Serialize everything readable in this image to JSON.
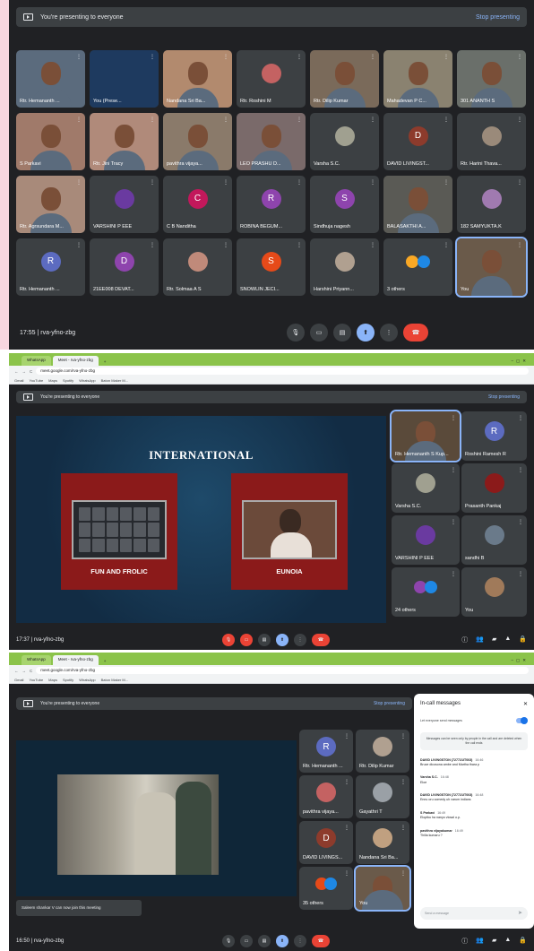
{
  "colors": {
    "meet_bg": "#202124",
    "tile_bg": "#3c4043",
    "accent_blue": "#8ab4f8",
    "end_red": "#ea4335",
    "browser_green": "#8bc34a"
  },
  "panel1": {
    "banner": {
      "text": "You're presenting to everyone",
      "stop": "Stop presenting"
    },
    "tiles": [
      {
        "name": "Rtr. Hemananth ...",
        "kind": "video",
        "color": "#5b6b7d"
      },
      {
        "name": "You (Prese...",
        "kind": "screen",
        "color": "#1e3a5f"
      },
      {
        "name": "Nandana Sri Ba...",
        "kind": "video",
        "color": "#b28a6e"
      },
      {
        "name": "Rtr. Roshini M",
        "kind": "photo",
        "color": "#c46262"
      },
      {
        "name": "Rtr. Dilip Kumar",
        "kind": "video",
        "color": "#7a6a5a"
      },
      {
        "name": "Mahadevan P C...",
        "kind": "video",
        "color": "#8a8270"
      },
      {
        "name": "301 ANANTH S",
        "kind": "video",
        "color": "#6a6f6a"
      },
      {
        "name": "S Parkavi",
        "kind": "video",
        "color": "#a07a6a"
      },
      {
        "name": "Rtr. Jini Tracy",
        "kind": "video",
        "color": "#b08a7a"
      },
      {
        "name": "pavithra vijaya...",
        "kind": "video",
        "color": "#8a7a6a"
      },
      {
        "name": "LEO PRASHU D...",
        "kind": "video",
        "color": "#7a6a6a"
      },
      {
        "name": "Varsha S.C.",
        "kind": "photo",
        "color": "#a0a090"
      },
      {
        "name": "DAVID LIVINGST...",
        "kind": "avatar",
        "letter": "D",
        "color": "#8d3b2c"
      },
      {
        "name": "Rtr. Harini Thava...",
        "kind": "photo",
        "color": "#9a8a7a"
      },
      {
        "name": "Rtr. Agrsundara M...",
        "kind": "video",
        "color": "#a88a7a"
      },
      {
        "name": "VARSHINI P EEE",
        "kind": "photo",
        "color": "#6a3aa0"
      },
      {
        "name": "C B Nanditha",
        "kind": "avatar",
        "letter": "C",
        "color": "#c2185b"
      },
      {
        "name": "ROBINA BEGUM...",
        "kind": "avatar",
        "letter": "R",
        "color": "#8e44ad"
      },
      {
        "name": "Sindhuja nagesh",
        "kind": "avatar",
        "letter": "S",
        "color": "#8e44ad"
      },
      {
        "name": "BALASAKTHI A...",
        "kind": "video",
        "color": "#5a5a55"
      },
      {
        "name": "182 SAMYUKTA.K",
        "kind": "photo",
        "color": "#a07ab0"
      },
      {
        "name": "Rtr. Hemananth ...",
        "kind": "avatar",
        "letter": "R",
        "color": "#5c6bc0"
      },
      {
        "name": "21EE008 DEVAT...",
        "kind": "avatar",
        "letter": "D",
        "color": "#8e44ad"
      },
      {
        "name": "Rtr. Solmaa A S",
        "kind": "photo",
        "color": "#c08a7a"
      },
      {
        "name": "SNOWLIN JECI...",
        "kind": "avatar",
        "letter": "S",
        "color": "#e64a19"
      },
      {
        "name": "Harshini Priyann...",
        "kind": "photo",
        "color": "#b0a090"
      },
      {
        "name": "3 others",
        "kind": "others",
        "color": "#f9a825"
      },
      {
        "name": "You",
        "kind": "self",
        "color": "#6a5a4a"
      }
    ],
    "time": "17:55",
    "meeting_code": "rva-yfno-zbg"
  },
  "browser": {
    "tab1": "WhatsApp",
    "tab2": "Meet - rva-yfno-zbg",
    "url": "meet.google.com/rva-yfno-zbg",
    "bookmarks": [
      "Gmail",
      "YouTube",
      "Maps",
      "Spotify",
      "WhatsApp",
      "Baton Maker M..."
    ]
  },
  "panel2": {
    "banner": {
      "text": "You're presenting to everyone",
      "stop": "Stop presenting"
    },
    "slide_title": "INTERNATIONAL",
    "card1": "FUN AND FROLIC",
    "card2": "EUNOIA",
    "tiles": [
      {
        "name": "Rtr. Hemananth S Kup...",
        "kind": "self",
        "color": "#5a4a3a"
      },
      {
        "name": "Roshini Ramesh R",
        "kind": "avatar",
        "letter": "R",
        "color": "#5c6bc0"
      },
      {
        "name": "Varsha S.C.",
        "kind": "photo",
        "color": "#a0a090"
      },
      {
        "name": "Prasanth Pankaj",
        "kind": "photo",
        "color": "#8b1a1a"
      },
      {
        "name": "VARSHINI P EEE",
        "kind": "photo",
        "color": "#6a3aa0"
      },
      {
        "name": "sandhi B",
        "kind": "photo",
        "color": "#6a7a8a"
      },
      {
        "name": "24 others",
        "kind": "others",
        "color": "#8e44ad"
      },
      {
        "name": "You",
        "kind": "photo",
        "color": "#a07a5a"
      }
    ],
    "time": "17:37",
    "meeting_code": "rva-yfno-zbg"
  },
  "panel3": {
    "banner": {
      "text": "You're presenting to everyone",
      "stop": "Stop presenting"
    },
    "toast": "Saleem shankar V can now join this meeting",
    "tiles": [
      {
        "name": "Rtr. Hemananth ...",
        "kind": "avatar",
        "letter": "R",
        "color": "#5c6bc0"
      },
      {
        "name": "Rtr. Dilip Kumar",
        "kind": "photo",
        "color": "#b0a090"
      },
      {
        "name": "pavithra vijaya...",
        "kind": "photo",
        "color": "#c46262"
      },
      {
        "name": "Gayathri T",
        "kind": "photo",
        "color": "#9aa0a6"
      },
      {
        "name": "DAVID LIVINGS...",
        "kind": "avatar",
        "letter": "D",
        "color": "#8d3b2c"
      },
      {
        "name": "Nandana Sri Ba...",
        "kind": "photo",
        "color": "#c0a080"
      },
      {
        "name": "35 others",
        "kind": "others",
        "color": "#e64a19"
      },
      {
        "name": "You",
        "kind": "self",
        "color": "#6a5a4a"
      }
    ],
    "chat": {
      "title": "In-call messages",
      "toggle": "Let everyone send messages",
      "note": "Messages can be seen only by people in the call and are deleted when the call ends",
      "messages": [
        {
          "who": "DAVID LIVINGSTON (727721IT003)",
          "time": "16:46",
          "text": "Bruce dicosona ambe and Martha thara p"
        },
        {
          "who": "Varsha S.C.",
          "time": "16:48",
          "text": "Eloe"
        },
        {
          "who": "DAVID LIVINGSTON (727721IT003)",
          "time": "16:48",
          "text": "Ennu oru comedy uh varum indians"
        },
        {
          "who": "S Parkavi",
          "time": "16:49",
          "text": "Eloptku ha nanyo vlosal o.p."
        },
        {
          "who": "pavithra vijayakumar",
          "time": "16:49",
          "text": "Thilla kumaru ?"
        }
      ],
      "input_placeholder": "Send a message"
    },
    "time": "16:50",
    "meeting_code": "rva-yfno-zbg"
  }
}
